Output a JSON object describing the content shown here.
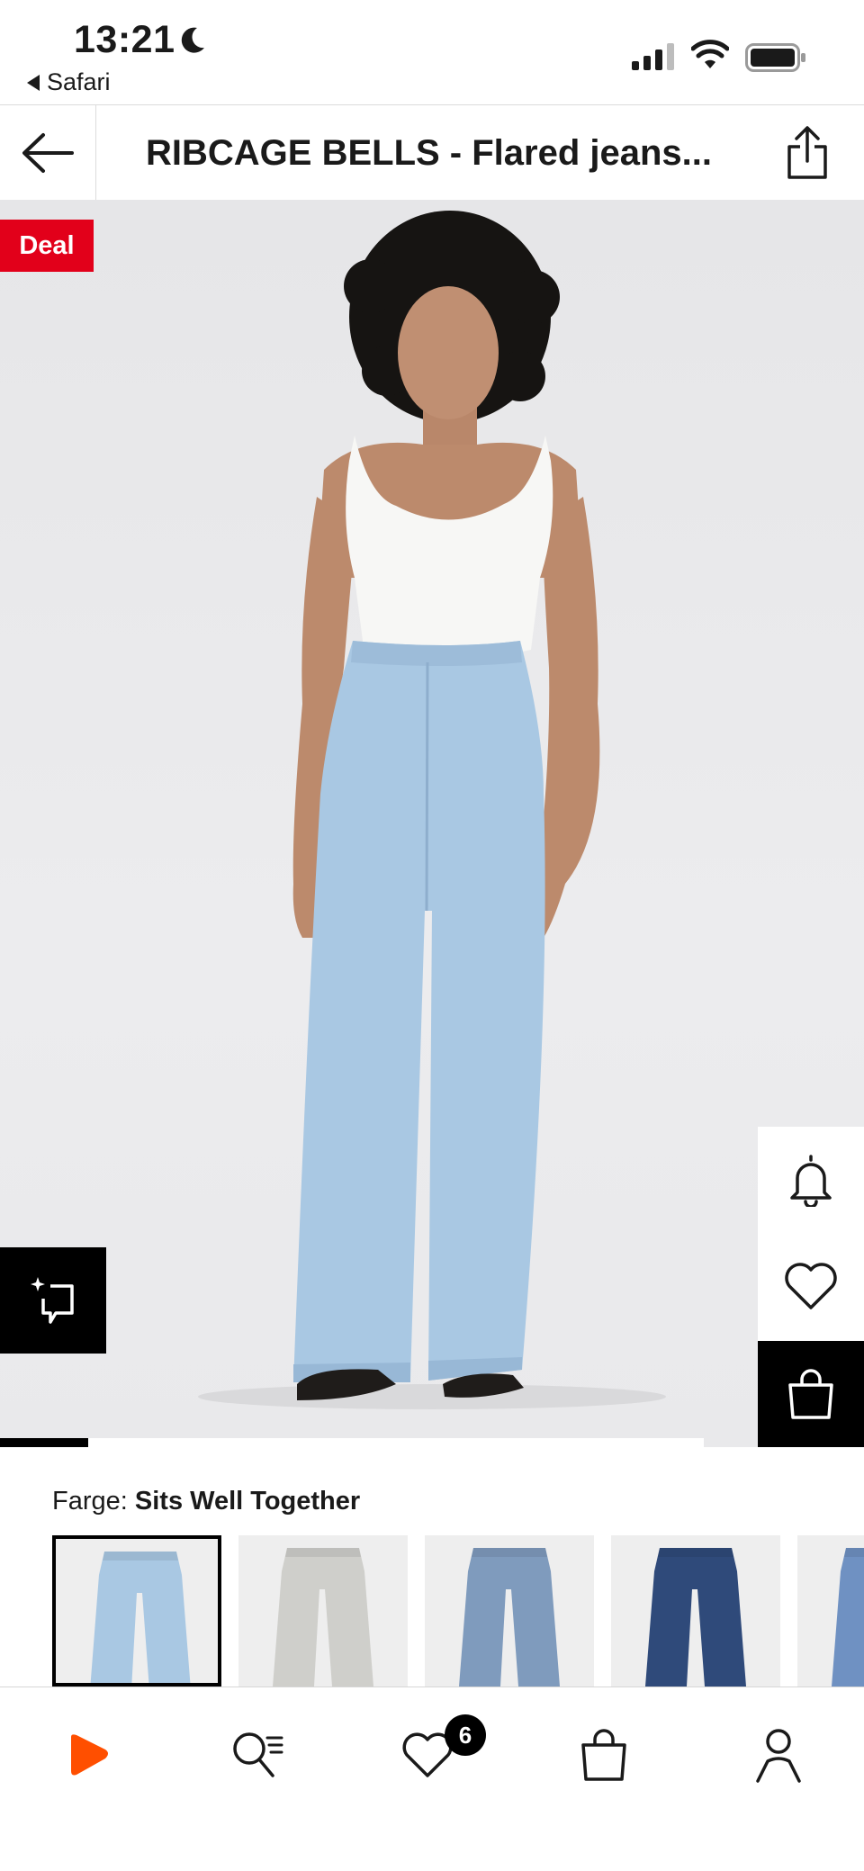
{
  "status_bar": {
    "time": "13:21",
    "back_app": "Safari",
    "icons": [
      "moon-icon",
      "signal-icon",
      "wifi-icon",
      "battery-icon"
    ]
  },
  "header": {
    "title": "RIBCAGE BELLS - Flared jeans...",
    "icons": [
      "back-arrow-icon",
      "share-icon"
    ]
  },
  "product": {
    "badge": "Deal",
    "badge_color": "#e2001a",
    "gallery_progress": 0.125,
    "actions": [
      "bell-icon",
      "heart-icon",
      "shopping-bag-icon",
      "ai-sparkle-icon"
    ]
  },
  "color_selector": {
    "label": "Farge:",
    "selected_value": "Sits Well Together",
    "swatches": [
      {
        "tone": "#a9c8e3",
        "selected": true
      },
      {
        "tone": "#cfcfcb",
        "selected": false
      },
      {
        "tone": "#7f9bbd",
        "selected": false
      },
      {
        "tone": "#2f4a7a",
        "selected": false
      },
      {
        "tone": "#6f91c2",
        "selected": false
      }
    ]
  },
  "bottom_nav": {
    "items": [
      "home-logo-icon",
      "search-icon",
      "wishlist-icon",
      "bag-icon",
      "account-icon"
    ],
    "wishlist_count": "6",
    "brand_color": "#ff4f00"
  }
}
